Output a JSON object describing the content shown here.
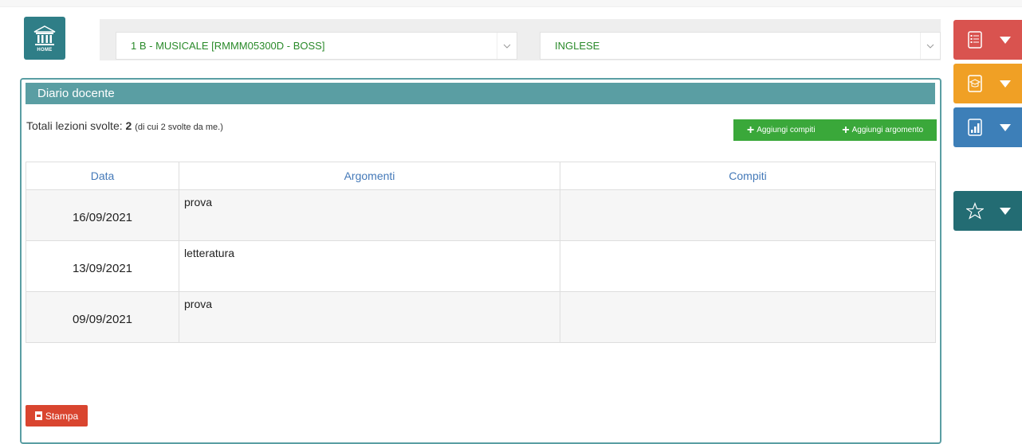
{
  "home": {
    "label": "HOME"
  },
  "selectors": {
    "class_value": "1 B - MUSICALE [RMMM05300D - BOSS]",
    "subject_value": "INGLESE"
  },
  "panel": {
    "title": "Diario docente",
    "totals_label": "Totali lezioni svolte: ",
    "totals_count": "2",
    "totals_note": "(di cui 2 svolte da me.)"
  },
  "actions": {
    "add_homework": "Aggiungi compiti",
    "add_topic": "Aggiungi argomento",
    "print": "Stampa"
  },
  "table": {
    "headers": [
      "Data",
      "Argomenti",
      "Compiti"
    ],
    "rows": [
      {
        "date": "16/09/2021",
        "topic": "prova",
        "homework": ""
      },
      {
        "date": "13/09/2021",
        "topic": "letteratura",
        "homework": ""
      },
      {
        "date": "09/09/2021",
        "topic": "prova",
        "homework": ""
      }
    ]
  },
  "side_menu": {
    "icons": [
      "checklist-icon",
      "graduation-cap-icon",
      "bar-chart-icon",
      "star-icon"
    ],
    "colors": {
      "red": "#d9534f",
      "orange": "#f0a025",
      "blue": "#3d7fb8",
      "teal": "#236c73"
    }
  },
  "colors": {
    "accent": "#5a9ea3",
    "green": "#3aa83a",
    "header_text": "#4479b8",
    "print": "#d9452f"
  }
}
